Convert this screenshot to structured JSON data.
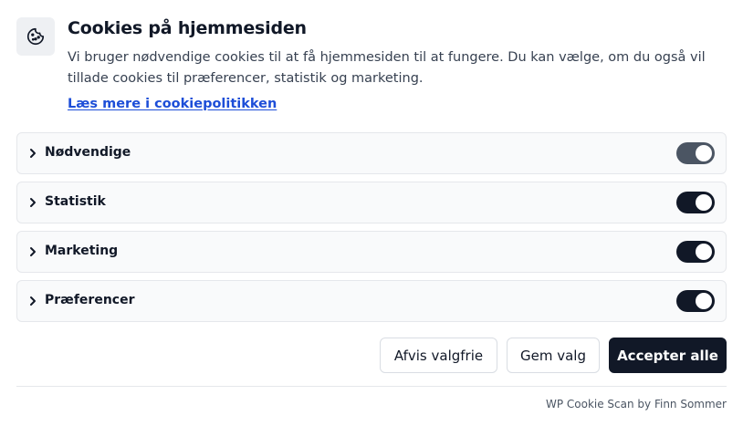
{
  "header": {
    "icon": "cookie-icon",
    "title": "Cookies på hjemmesiden",
    "description": "Vi bruger nødvendige cookies til at få hjemmesiden til at fungere. Du kan vælge, om du også vil tillade cookies til præferencer, statistik og marketing.",
    "policy_link": "Læs mere i cookiepolitikken"
  },
  "categories": [
    {
      "label": "Nødvendige",
      "enabled": true,
      "locked": true
    },
    {
      "label": "Statistik",
      "enabled": true,
      "locked": false
    },
    {
      "label": "Marketing",
      "enabled": true,
      "locked": false
    },
    {
      "label": "Præferencer",
      "enabled": true,
      "locked": false
    }
  ],
  "buttons": {
    "reject": "Afvis valgfrie",
    "save": "Gem valg",
    "accept": "Accepter alle"
  },
  "footer": {
    "credit": "WP Cookie Scan by Finn Sommer"
  },
  "colors": {
    "primary": "#111827",
    "link": "#1d4ed8",
    "toggle_locked": "#4b5563"
  }
}
